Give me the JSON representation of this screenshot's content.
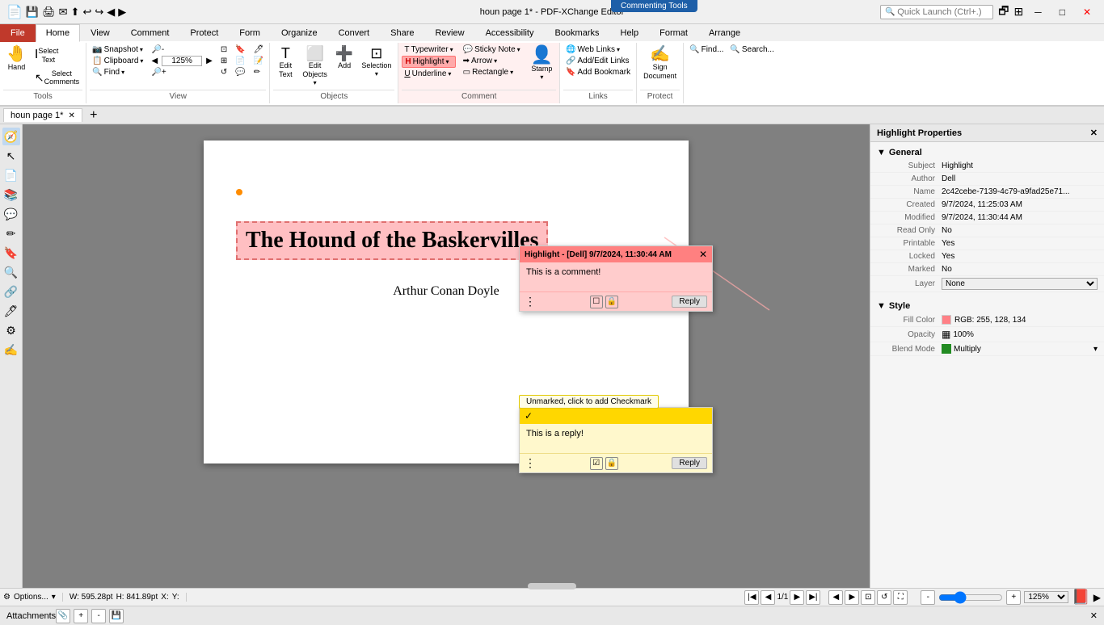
{
  "titlebar": {
    "title": "houn page 1* - PDF-XChange Editor",
    "commenting_bar": "Commenting Tools",
    "search_placeholder": "Quick Launch (Ctrl+.)",
    "min_btn": "─",
    "max_btn": "□",
    "close_btn": "✕"
  },
  "ribbon_tabs": [
    "File",
    "Home",
    "View",
    "Comment",
    "Protect",
    "Form",
    "Organize",
    "Convert",
    "Share",
    "Review",
    "Accessibility",
    "Bookmarks",
    "Help",
    "Format",
    "Arrange"
  ],
  "tools": {
    "hand": "Hand",
    "select_text": "Select\nText",
    "select_comments": "Select\nComments",
    "snapshot": "Snapshot",
    "clipboard": "Clipboard",
    "find": "Find",
    "edit_text": "Edit\nText",
    "edit_objects": "Edit\nObjects",
    "add": "Add",
    "selection": "Selection",
    "typewriter": "Typewriter",
    "highlight": "Highlight",
    "underline": "Underline",
    "sticky_note": "Sticky Note",
    "arrow": "Arrow",
    "rectangle": "Rectangle",
    "stamp": "Stamp",
    "web_links": "Web Links",
    "add_edit_links": "Add/Edit Links",
    "add_bookmark": "Add Bookmark",
    "sign_document": "Sign\nDocument",
    "find_toolbar": "Find...",
    "search": "Search..."
  },
  "groups": {
    "tools": "Tools",
    "view": "View",
    "objects": "Objects",
    "comment": "Comment",
    "links": "Links",
    "protect": "Protect"
  },
  "doc_tab": {
    "name": "houn page 1*",
    "modified": true
  },
  "document": {
    "title": "The Hound of the Baskervilles",
    "author": "Arthur Conan Doyle"
  },
  "comment_popup": {
    "header": "Highlight - [Dell]  9/7/2024, 11:30:44 AM",
    "body": "This is a comment!",
    "reply_btn": "Reply",
    "close_btn": "✕"
  },
  "reply_popup": {
    "body": "This is a reply!",
    "reply_btn": "Reply",
    "tooltip": "Unmarked, click to add Checkmark"
  },
  "properties_panel": {
    "title": "Highlight Properties",
    "close_btn": "✕",
    "general_section": "General",
    "style_section": "Style",
    "properties": {
      "subject_label": "Subject",
      "subject_value": "Highlight",
      "author_label": "Author",
      "author_value": "Dell",
      "name_label": "Name",
      "name_value": "2c42cebe-7139-4c79-a9fad25e71...",
      "created_label": "Created",
      "created_value": "9/7/2024, 11:25:03 AM",
      "modified_label": "Modified",
      "modified_value": "9/7/2024, 11:30:44 AM",
      "readonly_label": "Read Only",
      "readonly_value": "No",
      "printable_label": "Printable",
      "printable_value": "Yes",
      "locked_label": "Locked",
      "locked_value": "Yes",
      "marked_label": "Marked",
      "marked_value": "No",
      "layer_label": "Layer",
      "layer_value": "None",
      "fillcolor_label": "Fill Color",
      "fillcolor_value": "RGB: 255, 128, 134",
      "opacity_label": "Opacity",
      "opacity_value": "100%",
      "blendmode_label": "Blend Mode",
      "blendmode_value": "Multiply"
    }
  },
  "status_bar": {
    "options": "Options...",
    "width": "W: 595.28pt",
    "height": "H: 841.89pt",
    "x": "X:",
    "y": "Y:",
    "page": "1/1",
    "zoom": "125%"
  },
  "bottom_bar": {
    "label": "Attachments"
  },
  "colors": {
    "highlight_fill": "#FF8086",
    "reply_bg": "#FFD700",
    "comment_bg": "#FF8080",
    "accent_blue": "#1e5fa8"
  }
}
